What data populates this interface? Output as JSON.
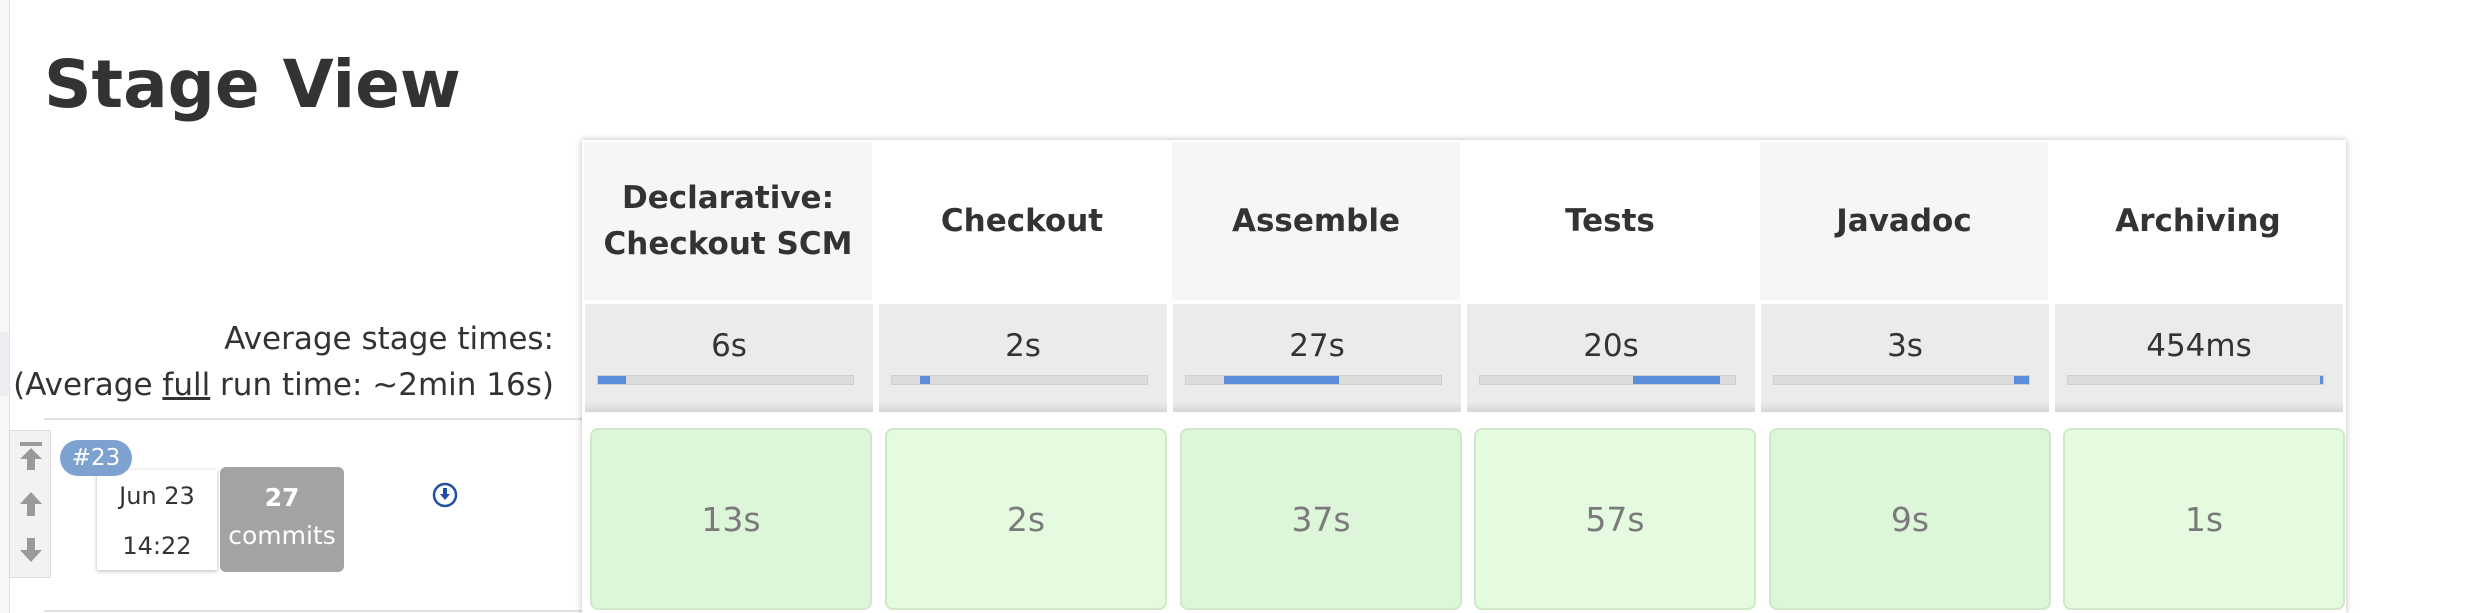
{
  "title": "Stage View",
  "average": {
    "label_line1": "Average stage times:",
    "label_prefix": "(Average ",
    "label_underlined": "full",
    "label_suffix": " run time: ~2min 16s)"
  },
  "stages": [
    {
      "name": "Declarative: Checkout SCM",
      "avg": "6s",
      "run": "13s",
      "avg_bar": {
        "start": 0.0,
        "end": 0.11
      }
    },
    {
      "name": "Checkout",
      "avg": "2s",
      "run": "2s",
      "avg_bar": {
        "start": 0.11,
        "end": 0.15
      }
    },
    {
      "name": "Assemble",
      "avg": "27s",
      "run": "37s",
      "avg_bar": {
        "start": 0.15,
        "end": 0.6
      }
    },
    {
      "name": "Tests",
      "avg": "20s",
      "run": "57s",
      "avg_bar": {
        "start": 0.6,
        "end": 0.94
      }
    },
    {
      "name": "Javadoc",
      "avg": "3s",
      "run": "9s",
      "avg_bar": {
        "start": 0.94,
        "end": 1.0
      }
    },
    {
      "name": "Archiving",
      "avg": "454ms",
      "run": "1s",
      "avg_bar": {
        "start": 0.99,
        "end": 1.0
      }
    }
  ],
  "build": {
    "number": "#23",
    "date": "Jun 23",
    "time": "14:22",
    "commits_count": "27",
    "commits_label": "commits"
  },
  "icons": {
    "scroll_top": "scroll-to-top-icon",
    "scroll_up": "scroll-up-icon",
    "scroll_down": "scroll-down-icon",
    "download": "download-circle-icon"
  },
  "colors": {
    "progress_fill": "#5b8dd9",
    "success_cell": "#e1f7dd",
    "badge": "#7ea2cf",
    "commits_bg": "#a3a3a3"
  }
}
